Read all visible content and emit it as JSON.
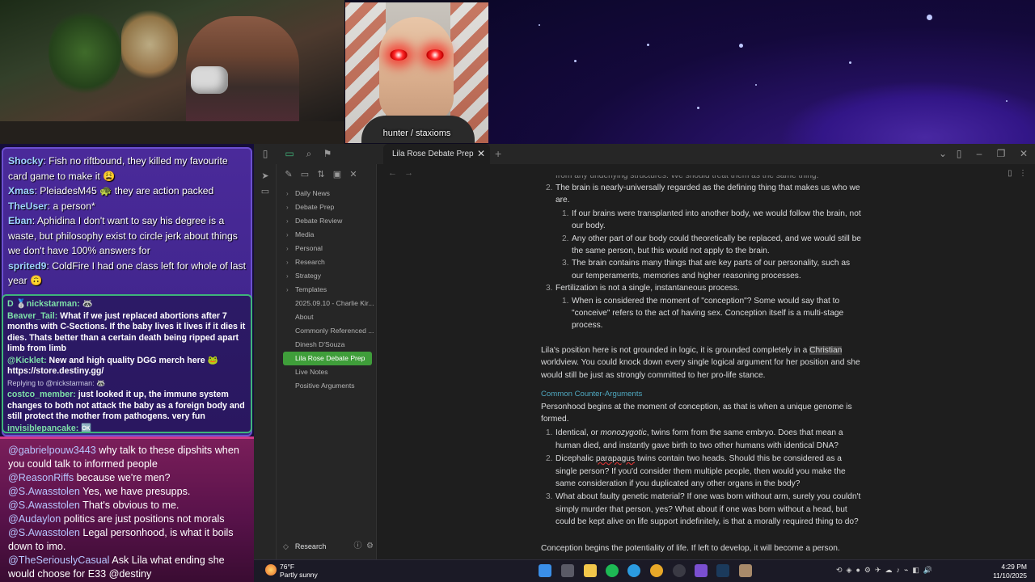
{
  "stream": {
    "guest_caption": "hunter / staxioms"
  },
  "chat": {
    "top": [
      {
        "name": "Shocky",
        "text": ": Fish no riftbound, they killed my favourite card game to make it 😩"
      },
      {
        "name": "Xmas",
        "text": ": PleiadesM45 🐢 they are action packed"
      },
      {
        "name": "TheUser",
        "text": ": a person*"
      },
      {
        "name": "Eban",
        "text": ": Aphidina I don't want to say his degree is a waste, but philosophy exist to circle jerk about things we don't have 100% answers for"
      },
      {
        "name": "sprited9",
        "text": ": ColdFire I had one class left for whole of last year 🙃"
      }
    ],
    "middle": [
      {
        "name": "D 🥈nickstarman:",
        "text": " 🦝"
      },
      {
        "name": "Beaver_Tail:",
        "text": " What if we just replaced abortions after 7 months with C-Sections. If the baby lives it lives if it dies it dies. Thats better than a certain death being ripped apart limb from limb"
      },
      {
        "name": "@Kicklet:",
        "text": " New and high quality DGG merch here 🐸 https://store.destiny.gg/"
      },
      {
        "name": "",
        "text": "Replying to @nickstarman: 🦝",
        "reply": true
      },
      {
        "name": "costco_member:",
        "text": " just looked it up, the immune system changes to both not attack the baby as a foreign body and still protect the mother from pathogens. very fun"
      },
      {
        "name": "invisiblepancake:",
        "text": " 🆗"
      }
    ],
    "bottom": [
      {
        "name": "@gabrielpouw3443",
        "text": " why talk to these dipshits when you could talk to informed people"
      },
      {
        "name": "@ReasonRiffs",
        "text": " because we're men?"
      },
      {
        "name": "@S.Awasstolen",
        "text": " Yes, we have presupps."
      },
      {
        "name": "@S.Awasstolen",
        "text": " That's obvious to me."
      },
      {
        "name": "@Audaylon",
        "text": " politics are just positions not morals"
      },
      {
        "name": "@S.Awasstolen",
        "text": " Legal personhood, is what it boils down to imo."
      },
      {
        "name": "@TheSeriouslyCasual",
        "text": " Ask Lila what ending she would choose for E33 @destiny"
      }
    ]
  },
  "app": {
    "tab_title": "Lila Rose Debate Prep",
    "vault_name": "Research",
    "tree": [
      {
        "label": "Daily News",
        "folder": true
      },
      {
        "label": "Debate Prep",
        "folder": true
      },
      {
        "label": "Debate Review",
        "folder": true
      },
      {
        "label": "Media",
        "folder": true
      },
      {
        "label": "Personal",
        "folder": true
      },
      {
        "label": "Research",
        "folder": true
      },
      {
        "label": "Strategy",
        "folder": true
      },
      {
        "label": "Templates",
        "folder": true
      },
      {
        "label": "2025.09.10 - Charlie Kir...",
        "folder": false
      },
      {
        "label": "About",
        "folder": false
      },
      {
        "label": "Commonly Referenced ...",
        "folder": false
      },
      {
        "label": "Dinesh D'Souza",
        "folder": false
      },
      {
        "label": "Lila Rose Debate Prep",
        "folder": false,
        "active": true
      },
      {
        "label": "Live Notes",
        "folder": false
      },
      {
        "label": "Positive Arguments",
        "folder": false
      }
    ],
    "doc": {
      "top_cut": "from any underlying structures. We should treat them as the same thing.",
      "item2": "The brain is nearly-universally regarded as the defining thing that makes us who we are.",
      "item2_sub": [
        "If our brains were transplanted into another body, we would follow the brain, not our body.",
        "Any other part of our body could theoretically be replaced, and we would still be the same person, but this would not apply to the brain.",
        "The brain contains many things that are key parts of our personality, such as our temperaments, memories and higher reasoning processes."
      ],
      "item3": "Fertilization is not a single, instantaneous process.",
      "item3_sub": [
        "When is considered the moment of \"conception\"? Some would say that to \"conceive\" refers to the act of having sex. Conception itself is a multi-stage process."
      ],
      "para1_a": "Lila's position here is not grounded in logic, it is grounded completely in a ",
      "para1_hl": "Christian",
      "para1_b": " worldview. You could knock down every single logical argument for her position and she would still be just as strongly committed to her pro-life stance.",
      "subheading": "Common Counter-Arguments",
      "para2": "Personhood begins at the moment of conception, as that is when a unique genome is formed.",
      "list2_1a": "Identical, or ",
      "list2_1i": "monozygotic",
      "list2_1b": ", twins form from the same embryo. Does that mean a human died, and instantly gave birth to two other humans with identical DNA?",
      "list2_2a": "Dicephalic ",
      "list2_2s": "parapagus",
      "list2_2b": " twins contain two heads. Should this be considered as a single person? If you'd consider them multiple people, then would you make the same consideration if you duplicated any other organs in the body?",
      "list2_3": "What about faulty genetic material? If one was born without arm, surely you couldn't simply murder that person, yes? What about if one was born without a head, but could be kept alive on life support indefinitely, is that a morally required thing to do?",
      "para3": "Conception begins the potentiality of life. If left to develop, it will become a person."
    }
  },
  "taskbar": {
    "temp": "76°F",
    "condition": "Partly sunny",
    "time": "4:29 PM",
    "date": "11/10/2025"
  }
}
